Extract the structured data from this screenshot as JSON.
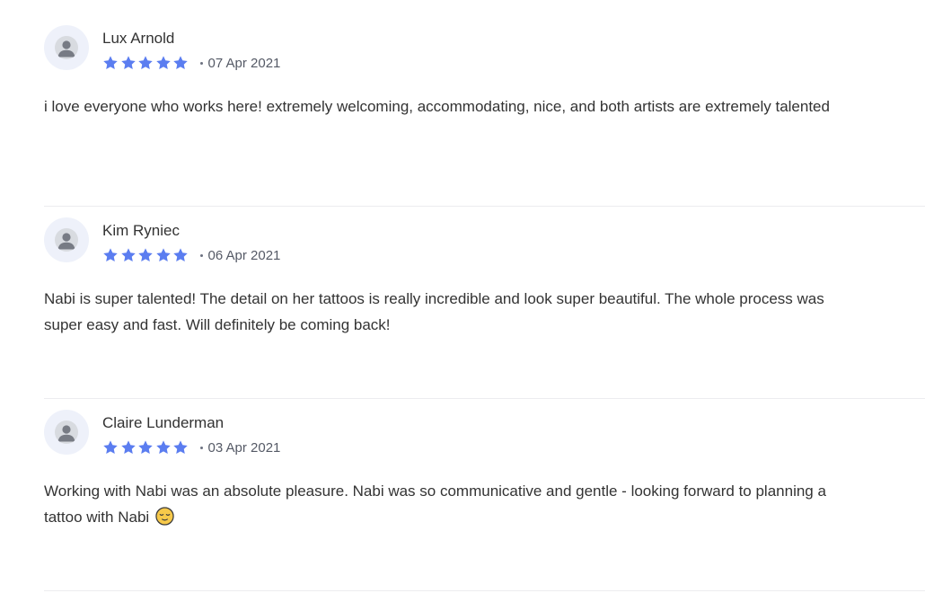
{
  "reviews": [
    {
      "name": "Lux Arnold",
      "rating": 5,
      "date": "07 Apr 2021",
      "text": "i love everyone who works here! extremely welcoming, accommodating, nice, and both artists are extremely talented",
      "emoji": ""
    },
    {
      "name": "Kim Ryniec",
      "rating": 5,
      "date": "06 Apr 2021",
      "text": "Nabi is super talented! The detail on her tattoos is really incredible and look super beautiful. The whole process was super easy and fast. Will definitely be coming back!",
      "emoji": ""
    },
    {
      "name": "Claire Lunderman",
      "rating": 5,
      "date": "03 Apr 2021",
      "text": "Working with Nabi was an absolute pleasure. Nabi was so communicative and gentle - looking forward to planning a tattoo with Nabi",
      "emoji": "relieved-face-icon"
    }
  ],
  "colors": {
    "star": "#5b7df0",
    "avatar_bg": "#eef1fa",
    "text": "#333333",
    "date": "#555a66",
    "divider": "#ececef"
  },
  "icons": {
    "avatar": "user-avatar-icon",
    "star": "star-icon"
  }
}
